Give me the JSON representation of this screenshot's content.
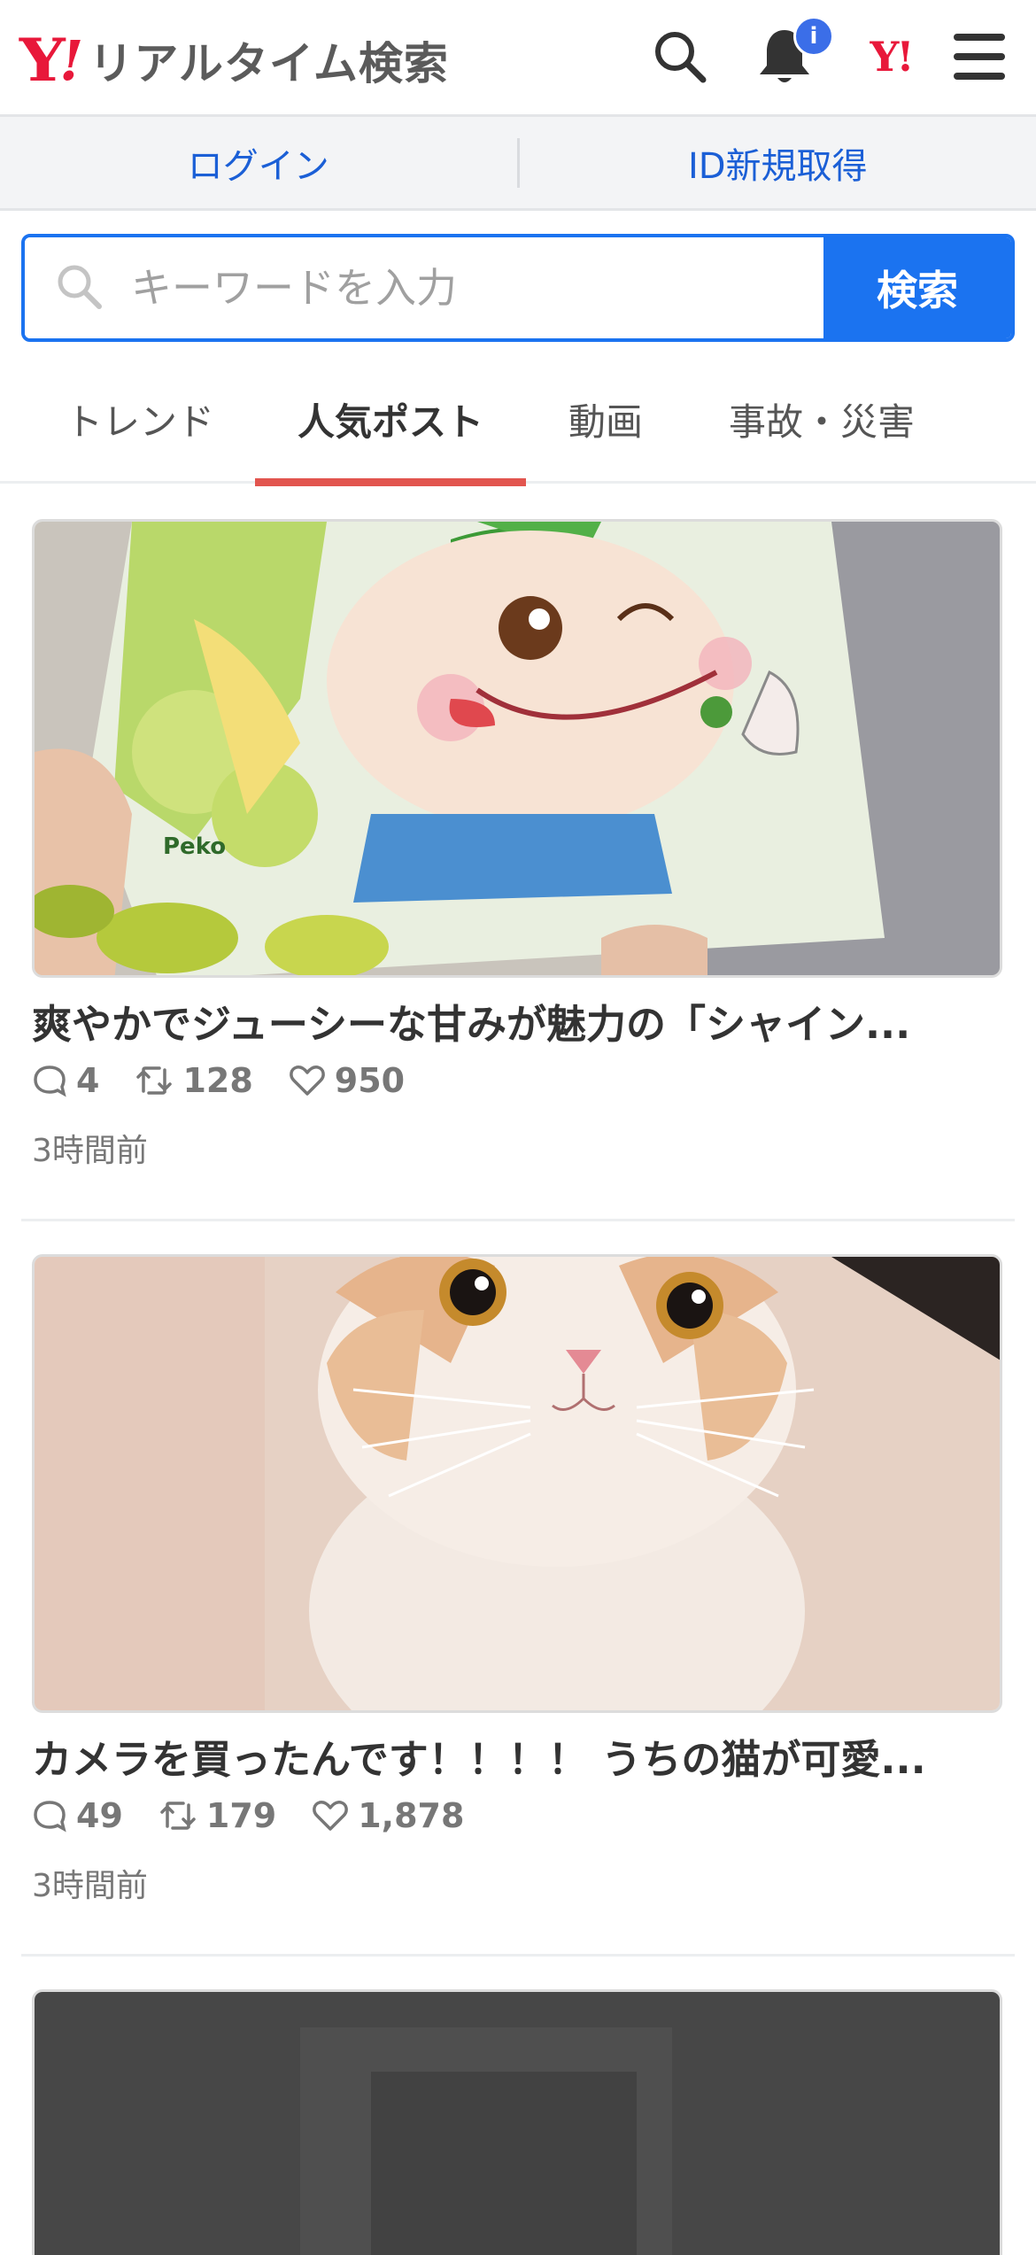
{
  "header": {
    "logo_y": "Y",
    "logo_excl": "!",
    "logo_text": "リアルタイム検索",
    "notification_badge": "i",
    "yahoo_mark": "Y!",
    "icons": [
      "search-icon",
      "bell-icon",
      "yahoo-logo-icon",
      "menu-icon"
    ],
    "colors": {
      "brand_red": "#e8183a",
      "badge_blue": "#3b6ee8"
    }
  },
  "account": {
    "login_label": "ログイン",
    "signup_label": "ID新規取得",
    "link_color": "#1b5fd6"
  },
  "search": {
    "placeholder": "キーワードを入力",
    "value": "",
    "button_label": "検索",
    "accent_color": "#1b73f0"
  },
  "tabs": [
    {
      "label": "トレンド",
      "active": false
    },
    {
      "label": "人気ポスト",
      "active": true
    },
    {
      "label": "動画",
      "active": false
    },
    {
      "label": "事故・災害",
      "active": false
    }
  ],
  "posts": [
    {
      "image": "candy-pack-photo",
      "title": "爽やかでジューシーな甘みが魅力の「シャイン...",
      "replies": "4",
      "reposts": "128",
      "likes": "950",
      "time": "3時間前"
    },
    {
      "image": "kitten-photo",
      "title": "カメラを買ったんです！！！！ うちの猫が可愛...",
      "replies": "49",
      "reposts": "179",
      "likes": "1,878",
      "time": "3時間前"
    },
    {
      "image": "dark-video-thumbnail"
    }
  ]
}
